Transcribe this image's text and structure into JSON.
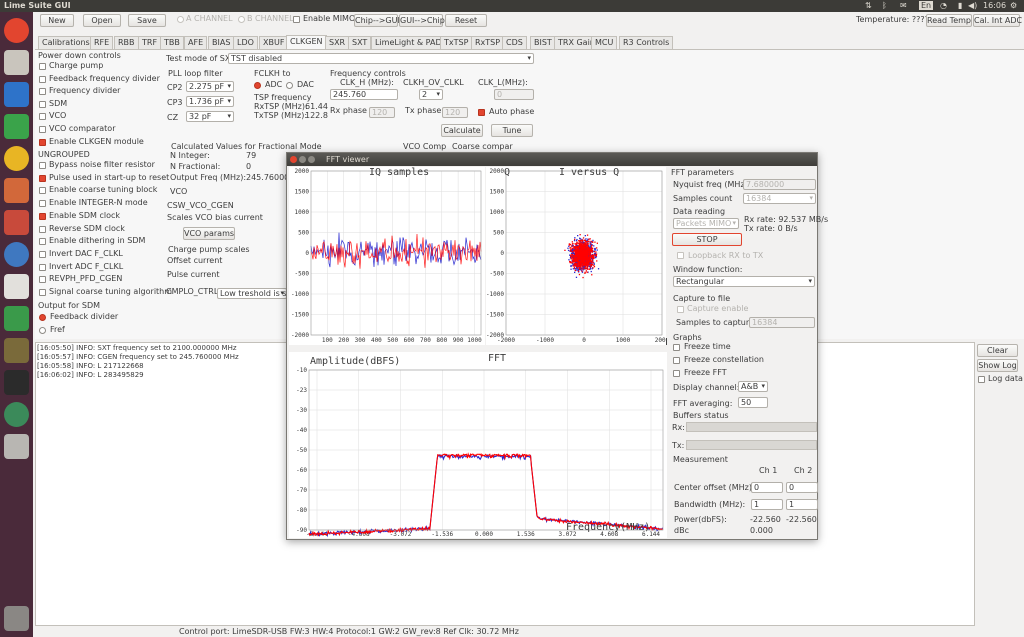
{
  "topbar": {
    "title": "Lime Suite GUI",
    "clock": "16:06",
    "keyboard": "En"
  },
  "toolbar": {
    "new": "New",
    "open": "Open",
    "save": "Save",
    "a_channel": "A CHANNEL",
    "b_channel": "B CHANNEL",
    "enable_mimo": "Enable MIMO",
    "chip_to_gui": "Chip-->GUI",
    "gui_to_chip": "GUI-->Chip",
    "reset": "Reset",
    "temperature": "Temperature: ?????",
    "read_temp": "Read Temp",
    "cal_int_adc": "Cal. Int ADC"
  },
  "tabs": [
    "Calibrations",
    "RFE",
    "RBB",
    "TRF",
    "TBB",
    "AFE",
    "BIAS",
    "LDO",
    "XBUF",
    "CLKGEN",
    "SXR",
    "SXT",
    "LimeLight & PAD",
    "TxTSP",
    "RxTSP",
    "CDS",
    "BIST",
    "TRX Gain",
    "MCU",
    "R3 Controls"
  ],
  "pdc": {
    "title": "Power down controls",
    "items": [
      {
        "label": "Charge pump",
        "checked": false
      },
      {
        "label": "Feedback frequency divider",
        "checked": false
      },
      {
        "label": "Frequency divider",
        "checked": false
      },
      {
        "label": "SDM",
        "checked": false
      },
      {
        "label": "VCO",
        "checked": false
      },
      {
        "label": "VCO comparator",
        "checked": false
      },
      {
        "label": "Enable CLKGEN module",
        "checked": true
      }
    ]
  },
  "ungrouped": {
    "title": "UNGROUPED",
    "items": [
      {
        "label": "Bypass noise filter resistor",
        "checked": false
      },
      {
        "label": "Pulse used in start-up to reset",
        "checked": true
      },
      {
        "label": "Enable coarse tuning block",
        "checked": false
      },
      {
        "label": "Enable INTEGER-N mode",
        "checked": false
      },
      {
        "label": "Enable SDM clock",
        "checked": true
      },
      {
        "label": "Reverse SDM clock",
        "checked": false
      },
      {
        "label": "Enable dithering in SDM",
        "checked": false
      },
      {
        "label": "Invert DAC F_CLKL",
        "checked": false
      },
      {
        "label": "Invert ADC F_CLKL",
        "checked": false
      },
      {
        "label": "REVPH_PFD_CGEN",
        "checked": false
      },
      {
        "label": "Signal coarse tuning algorithm",
        "checked": false
      }
    ]
  },
  "sdm_out": {
    "title": "Output for SDM",
    "opt1": "Feedback divider",
    "opt2": "Fref"
  },
  "test_mode": {
    "label": "Test mode of SX",
    "value": "TST disabled"
  },
  "pll": {
    "title": "PLL loop filter",
    "cp2_label": "CP2",
    "cp2": "2.275 pF",
    "cp3_label": "CP3",
    "cp3": "1.736 pF",
    "cz_label": "CZ",
    "cz": "32 pF"
  },
  "fclkh": {
    "title": "FCLKH to",
    "adc": "ADC",
    "dac": "DAC",
    "tsp_title": "TSP frequency",
    "rxtsp": "RxTSP (MHz):",
    "rxtsp_val": "61.44",
    "txtsp": "TxTSP (MHz):",
    "txtsp_val": "122.8"
  },
  "freq": {
    "title": "Frequency controls",
    "clkh_label": "CLK_H (MHz):",
    "clkh": "245.760",
    "ov_label": "CLKH_OV_CLKL",
    "ov": "2",
    "clkl_label": "CLK_L(MHz):",
    "clkl": "0",
    "rx_phase_label": "Rx phase",
    "rx_phase": "120",
    "tx_phase_label": "Tx phase",
    "tx_phase": "120",
    "auto_phase": "Auto phase",
    "calculate": "Calculate",
    "tune": "Tune"
  },
  "calc": {
    "title": "Calculated Values for Fractional Mode",
    "n_int_label": "N Integer:",
    "n_int": "79",
    "n_frac_label": "N Fractional:",
    "n_frac": "0",
    "out_label": "Output Freq (MHz):",
    "out": "245.760000",
    "vco_comp": "VCO Comp",
    "coarse": "Coarse compar"
  },
  "vco": {
    "title": "VCO",
    "csw": "CSW_VCO_CGEN",
    "scales": "Scales VCO bias current",
    "params": "VCO params"
  },
  "cps": {
    "title": "Charge pump scales",
    "offset": "Offset current",
    "pulse": "Pulse current",
    "cmplo": "CMPLO_CTRL:",
    "cmplo_val": "Low treshold is set"
  },
  "log": {
    "lines": [
      "[16:05:50] INFO: SXT frequency set to 2100.000000 MHz",
      "[16:05:57] INFO: CGEN frequency set to 245.760000 MHz",
      "[16:05:58] INFO: L 217122668",
      "[16:06:02] INFO: L 283495829"
    ],
    "clear": "Clear",
    "show_log": "Show Log",
    "log_data": "Log data"
  },
  "status": "Control port: LimeSDR-USB FW:3 HW:4 Protocol:1 GW:2 GW_rev:8 Ref Clk: 30.72 MHz",
  "fft": {
    "title": "FFT viewer",
    "iq_title": "IQ samples",
    "q_label": "Q",
    "ivq_title": "I versus Q",
    "amp_label": "Amplitude(dBFS)",
    "fft_title": "FFT",
    "freq_label": "Frequency(MHz)",
    "iq_y": [
      "2000",
      "1500",
      "1000",
      "500",
      "0",
      "-500",
      "-1000",
      "-1500",
      "-2000"
    ],
    "iq_x": [
      "100",
      "200",
      "300",
      "400",
      "500",
      "600",
      "700",
      "800",
      "900",
      "1000"
    ],
    "ivq_y": [
      "2000",
      "1500",
      "1000",
      "500",
      "0",
      "-500",
      "-1000",
      "-1500",
      "-2000"
    ],
    "ivq_x": [
      "-2000",
      "-1000",
      "0",
      "1000",
      "2000"
    ],
    "fft_y": [
      "-10",
      "-23",
      "-30",
      "-40",
      "-50",
      "-60",
      "-70",
      "-80",
      "-90"
    ],
    "fft_x": [
      "-6.144",
      "-4.608",
      "-3.072",
      "-1.536",
      "0.000",
      "1.536",
      "3.072",
      "4.608",
      "6.144"
    ],
    "params_title": "FFT parameters",
    "nyq_label": "Nyquist freq (MHz):",
    "nyq": "7.680000",
    "samples_label": "Samples count",
    "samples": "16384",
    "reading_title": "Data reading",
    "packets": "Packets MIMO",
    "rx_rate": "Rx rate: 92.537 MB/s",
    "tx_rate": "Tx rate: 0 B/s",
    "stop": "STOP",
    "loopback": "Loopback RX to TX",
    "window_title": "Window function:",
    "window": "Rectangular",
    "capture_title": "Capture to file",
    "capture_enable": "Capture enable",
    "samples_cap_label": "Samples to capture:",
    "samples_cap": "16384",
    "graphs_title": "Graphs",
    "freeze_time": "Freeze time",
    "freeze_const": "Freeze constellation",
    "freeze_fft": "Freeze FFT",
    "disp_label": "Display channel:",
    "disp": "A&B",
    "avg_label": "FFT averaging:",
    "avg": "50",
    "buffers_title": "Buffers status",
    "rx": "Rx:",
    "tx": "Tx:",
    "meas_title": "Measurement",
    "ch1": "Ch 1",
    "ch2": "Ch 2",
    "center_label": "Center offset (MHz):",
    "center1": "0",
    "center2": "0",
    "bw_label": "Bandwidth (MHz):",
    "bw1": "1",
    "bw2": "1",
    "power_label": "Power(dbFS):",
    "power1": "-22.560",
    "power2": "-22.560",
    "dbc_label": "dBc",
    "dbc": "0.000"
  },
  "colors": {
    "accent": "#e2452f",
    "ch_a": "#ff0000",
    "ch_b": "#2a2ad0"
  }
}
